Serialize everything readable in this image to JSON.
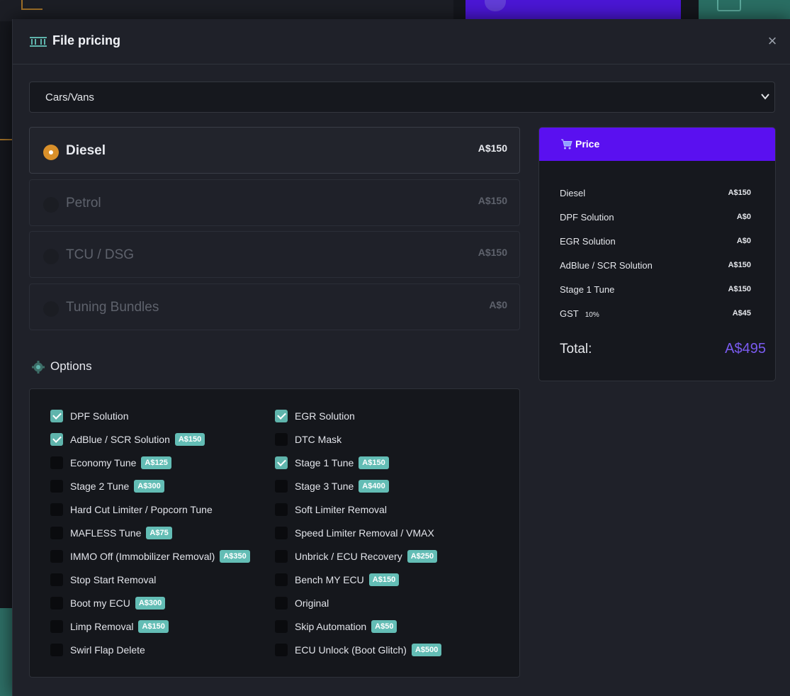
{
  "modal": {
    "title": "File pricing",
    "close_label": "×"
  },
  "category_select": {
    "value": "Cars/Vans"
  },
  "fuel_types": [
    {
      "label": "Diesel",
      "price": "A$150",
      "selected": true
    },
    {
      "label": "Petrol",
      "price": "A$150",
      "selected": false
    },
    {
      "label": "TCU / DSG",
      "price": "A$150",
      "selected": false
    },
    {
      "label": "Tuning Bundles",
      "price": "A$0",
      "selected": false
    }
  ],
  "options": {
    "heading": "Options",
    "items": [
      {
        "label": "DPF Solution",
        "badge": "",
        "checked": true
      },
      {
        "label": "EGR Solution",
        "badge": "",
        "checked": true
      },
      {
        "label": "AdBlue / SCR Solution",
        "badge": "A$150",
        "checked": true
      },
      {
        "label": "DTC Mask",
        "badge": "",
        "checked": false
      },
      {
        "label": "Economy Tune",
        "badge": "A$125",
        "checked": false
      },
      {
        "label": "Stage 1 Tune",
        "badge": "A$150",
        "checked": true
      },
      {
        "label": "Stage 2 Tune",
        "badge": "A$300",
        "checked": false
      },
      {
        "label": "Stage 3 Tune",
        "badge": "A$400",
        "checked": false
      },
      {
        "label": "Hard Cut Limiter / Popcorn Tune",
        "badge": "",
        "checked": false
      },
      {
        "label": "Soft Limiter Removal",
        "badge": "",
        "checked": false
      },
      {
        "label": "MAFLESS Tune",
        "badge": "A$75",
        "checked": false
      },
      {
        "label": "Speed Limiter Removal / VMAX",
        "badge": "",
        "checked": false
      },
      {
        "label": "IMMO Off (Immobilizer Removal)",
        "badge": "A$350",
        "checked": false
      },
      {
        "label": "Unbrick / ECU Recovery",
        "badge": "A$250",
        "checked": false
      },
      {
        "label": "Stop Start Removal",
        "badge": "",
        "checked": false
      },
      {
        "label": "Bench MY ECU",
        "badge": "A$150",
        "checked": false
      },
      {
        "label": "Boot my ECU",
        "badge": "A$300",
        "checked": false
      },
      {
        "label": "Original",
        "badge": "",
        "checked": false
      },
      {
        "label": "Limp Removal",
        "badge": "A$150",
        "checked": false
      },
      {
        "label": "Skip Automation",
        "badge": "A$50",
        "checked": false
      },
      {
        "label": "Swirl Flap Delete",
        "badge": "",
        "checked": false
      },
      {
        "label": "ECU Unlock (Boot Glitch)",
        "badge": "A$500",
        "checked": false
      }
    ]
  },
  "price_panel": {
    "title": "Price",
    "rows": [
      {
        "label": "Diesel",
        "rate": "",
        "value": "A$150"
      },
      {
        "label": "DPF Solution",
        "rate": "",
        "value": "A$0"
      },
      {
        "label": "EGR Solution",
        "rate": "",
        "value": "A$0"
      },
      {
        "label": "AdBlue / SCR Solution",
        "rate": "",
        "value": "A$150"
      },
      {
        "label": "Stage 1 Tune",
        "rate": "",
        "value": "A$150"
      },
      {
        "label": "GST",
        "rate": "10%",
        "value": "A$45"
      }
    ],
    "total_label": "Total:",
    "total_value": "A$495"
  },
  "colors": {
    "accent_purple": "#5a10f0",
    "total_purple": "#7a5bf0",
    "radio_orange": "#d9902a",
    "teal": "#5fb4ac"
  }
}
